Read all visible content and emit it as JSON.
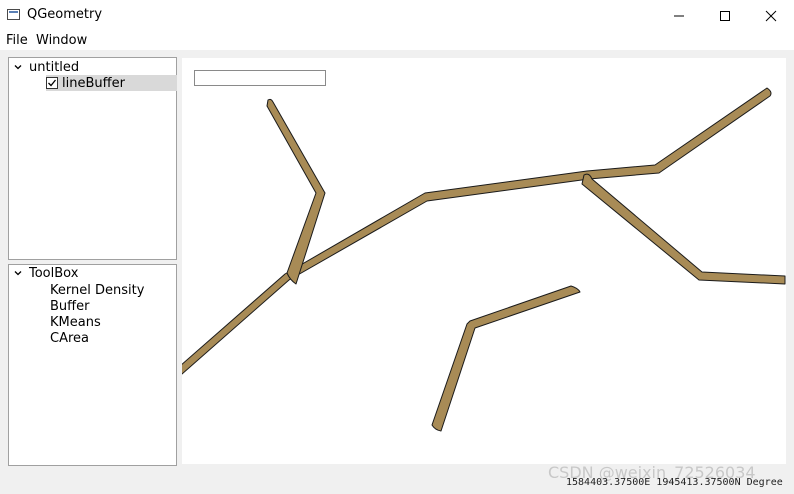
{
  "window": {
    "title": "QGeometry",
    "app_icon": "window-app-icon",
    "controls": [
      "minimize-icon",
      "maximize-icon",
      "close-icon"
    ]
  },
  "menu": {
    "file": "File",
    "window": "Window"
  },
  "layers": {
    "project": "untitled",
    "items": [
      {
        "label": "lineBuffer",
        "checked": true,
        "selected": true
      }
    ]
  },
  "toolbox": {
    "title": "ToolBox",
    "tools": [
      "Kernel Density",
      "Buffer",
      "KMeans",
      "CArea"
    ]
  },
  "map": {
    "coord_input_value": "",
    "buffer_fill": "#a88b56",
    "buffer_stroke": "#1a1a1a"
  },
  "status": {
    "coords": "1584403.37500E 1945413.37500N Degree"
  },
  "watermark": "CSDN @weixin_72526034"
}
